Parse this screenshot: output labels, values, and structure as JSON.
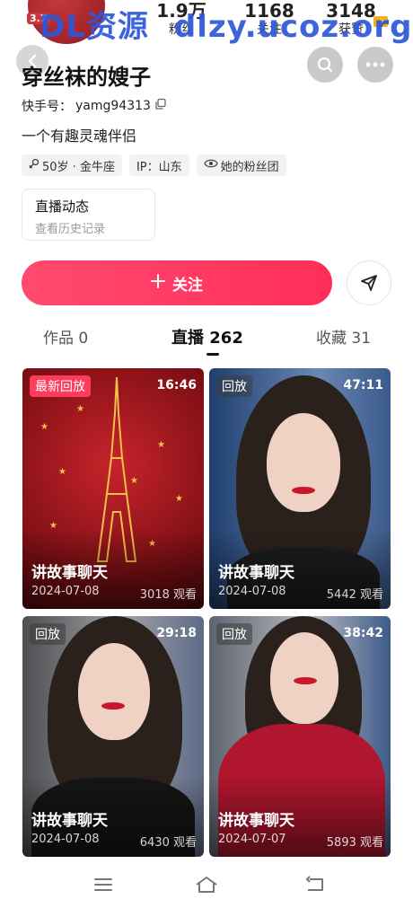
{
  "header": {
    "avatar_badge": "3.7",
    "watermark_cn": "DL资源",
    "watermark_url": "dlzy.ucoz.org",
    "stats": {
      "fans": {
        "value": "1.9万",
        "label": "粉丝"
      },
      "following": {
        "value": "1168",
        "label": "关注"
      },
      "likes": {
        "value": "3148",
        "label": "获赞"
      }
    }
  },
  "profile": {
    "name": "穿丝袜的嫂子",
    "kuaishou_id_label": "快手号：",
    "kuaishou_id": "yamg94313",
    "bio": "一个有趣灵魂伴侣",
    "tags": [
      {
        "icon": "female-icon",
        "text": "50岁 · 金牛座"
      },
      {
        "icon": "",
        "text": "IP：山东"
      },
      {
        "icon": "fan-group-icon",
        "text": "她的粉丝团"
      }
    ]
  },
  "live_history": {
    "title": "直播动态",
    "subtitle": "查看历史记录"
  },
  "actions": {
    "follow_label": "关注"
  },
  "tabs": [
    {
      "label": "作品 0"
    },
    {
      "label": "直播 262"
    },
    {
      "label": "收藏 31"
    }
  ],
  "videos": [
    {
      "badge": "最新回放",
      "duration": "16:46",
      "title": "讲故事聊天",
      "date": "2024-07-08",
      "views": "3018 观看"
    },
    {
      "badge": "回放",
      "duration": "47:11",
      "title": "讲故事聊天",
      "date": "2024-07-08",
      "views": "5442 观看"
    },
    {
      "badge": "回放",
      "duration": "29:18",
      "title": "讲故事聊天",
      "date": "2024-07-08",
      "views": "6430 观看"
    },
    {
      "badge": "回放",
      "duration": "38:42",
      "title": "讲故事聊天",
      "date": "2024-07-07",
      "views": "5893 观看"
    }
  ],
  "colors": {
    "follow_gradient_start": "#ff4a6e",
    "follow_gradient_end": "#ff2e58",
    "newest_badge": "#ff3b5c",
    "watermark": "#2d57d9"
  }
}
